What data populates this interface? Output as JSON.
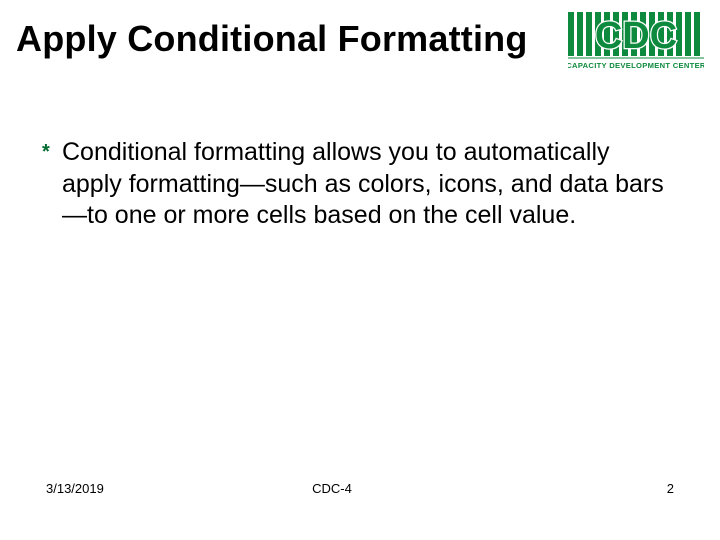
{
  "header": {
    "title": "Apply Conditional Formatting",
    "logo": {
      "abbr": "CDC",
      "subtitle": "CAPACITY DEVELOPMENT CENTER"
    }
  },
  "content": {
    "bullets": [
      {
        "text": "Conditional formatting allows you to automatically apply formatting—such as colors, icons, and data bars—to one or more cells based on the cell value."
      }
    ]
  },
  "footer": {
    "date": "3/13/2019",
    "center": "CDC-4",
    "page": "2"
  },
  "colors": {
    "accent": "#007a33"
  }
}
